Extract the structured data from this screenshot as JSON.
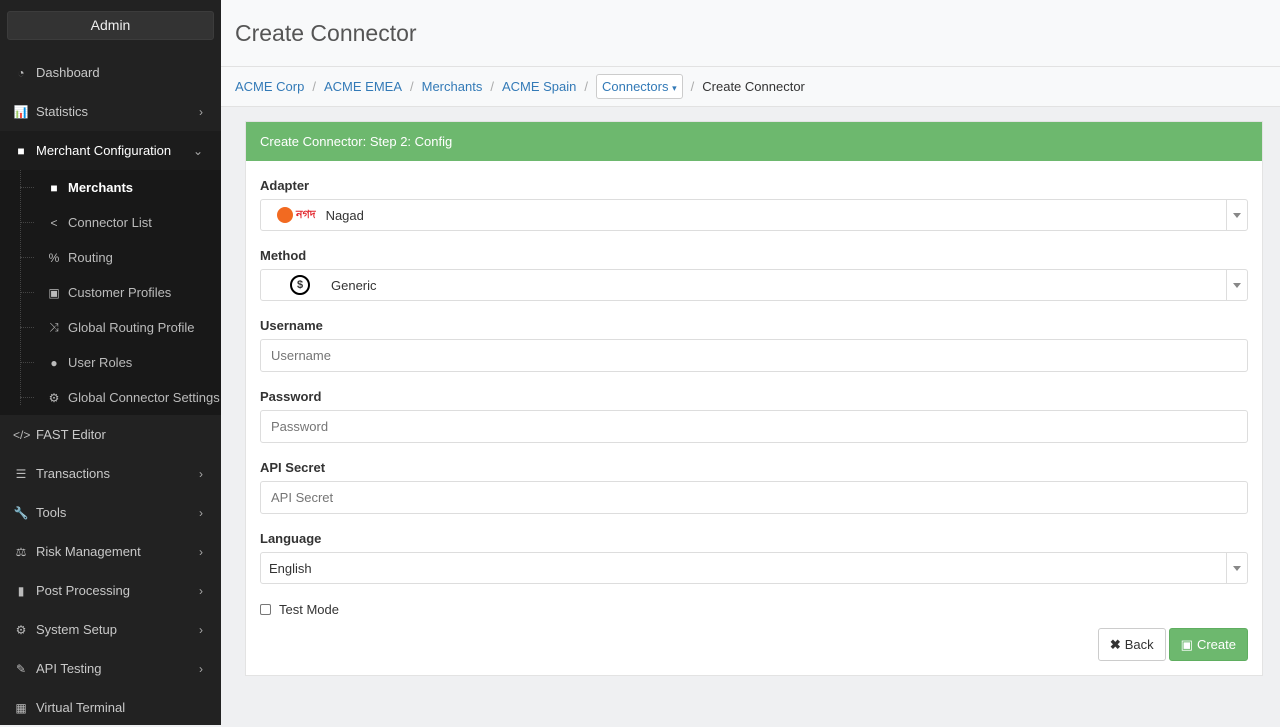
{
  "sidebar": {
    "admin": "Admin",
    "items": [
      {
        "label": "Dashboard",
        "icon": "dashboard-icon"
      },
      {
        "label": "Statistics",
        "icon": "bar-chart-icon"
      },
      {
        "label": "Merchant Configuration",
        "icon": "briefcase-icon"
      },
      {
        "label": "FAST Editor",
        "icon": "code-icon"
      },
      {
        "label": "Transactions",
        "icon": "list-icon"
      },
      {
        "label": "Tools",
        "icon": "wrench-icon"
      },
      {
        "label": "Risk Management",
        "icon": "balance-scale-icon"
      },
      {
        "label": "Post Processing",
        "icon": "microchip-icon"
      },
      {
        "label": "System Setup",
        "icon": "gear-icon"
      },
      {
        "label": "API Testing",
        "icon": "eyedropper-icon"
      },
      {
        "label": "Virtual Terminal",
        "icon": "calculator-icon"
      }
    ],
    "sub": [
      "Merchants",
      "Connector List",
      "Routing",
      "Customer Profiles",
      "Global Routing Profile",
      "User Roles",
      "Global Connector Settings"
    ]
  },
  "page": {
    "title": "Create Connector"
  },
  "breadcrumb": [
    "ACME Corp",
    "ACME EMEA",
    "Merchants",
    "ACME Spain",
    "Connectors",
    "Create Connector"
  ],
  "panel": {
    "title": "Create Connector: Step 2: Config",
    "adapter_label": "Adapter",
    "adapter_value": "Nagad",
    "adapter_logo": "নগদ",
    "method_label": "Method",
    "method_value": "Generic",
    "username_label": "Username",
    "username_placeholder": "Username",
    "password_label": "Password",
    "password_placeholder": "Password",
    "secret_label": "API Secret",
    "secret_placeholder": "API Secret",
    "language_label": "Language",
    "language_value": "English",
    "test_mode": "Test Mode",
    "back": "Back",
    "create": "Create"
  }
}
